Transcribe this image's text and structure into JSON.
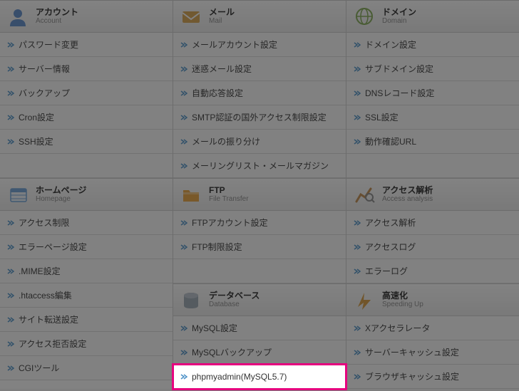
{
  "columns": [
    {
      "sections": [
        {
          "id": "account",
          "title_ja": "アカウント",
          "title_en": "Account",
          "icon": "account",
          "items": [
            {
              "label": "パスワード変更"
            },
            {
              "label": "サーバー情報"
            },
            {
              "label": "バックアップ"
            },
            {
              "label": "Cron設定"
            },
            {
              "label": "SSH設定"
            }
          ]
        },
        {
          "id": "homepage",
          "title_ja": "ホームページ",
          "title_en": "Homepage",
          "icon": "home",
          "items": [
            {
              "label": "アクセス制限"
            },
            {
              "label": "エラーページ設定"
            },
            {
              "label": ".MIME設定"
            },
            {
              "label": ".htaccess編集"
            },
            {
              "label": "サイト転送設定"
            },
            {
              "label": "アクセス拒否設定"
            },
            {
              "label": "CGIツール"
            }
          ]
        }
      ]
    },
    {
      "sections": [
        {
          "id": "mail",
          "title_ja": "メール",
          "title_en": "Mail",
          "icon": "mail",
          "items": [
            {
              "label": "メールアカウント設定"
            },
            {
              "label": "迷惑メール設定"
            },
            {
              "label": "自動応答設定"
            },
            {
              "label": "SMTP認証の国外アクセス制限設定"
            },
            {
              "label": "メールの振り分け"
            },
            {
              "label": "メーリングリスト・メールマガジン"
            }
          ]
        },
        {
          "id": "ftp",
          "title_ja": "FTP",
          "title_en": "File Transfer",
          "icon": "ftp",
          "items": [
            {
              "label": "FTPアカウント設定"
            },
            {
              "label": "FTP制限設定"
            }
          ]
        },
        {
          "id": "database",
          "title_ja": "データベース",
          "title_en": "Database",
          "icon": "db",
          "items": [
            {
              "label": "MySQL設定"
            },
            {
              "label": "MySQLバックアップ"
            },
            {
              "label": "phpmyadmin(MySQL5.7)",
              "highlight": true
            }
          ]
        }
      ]
    },
    {
      "sections": [
        {
          "id": "domain",
          "title_ja": "ドメイン",
          "title_en": "Domain",
          "icon": "domain",
          "items": [
            {
              "label": "ドメイン設定"
            },
            {
              "label": "サブドメイン設定"
            },
            {
              "label": "DNSレコード設定"
            },
            {
              "label": "SSL設定"
            },
            {
              "label": "動作確認URL"
            }
          ]
        },
        {
          "id": "access",
          "title_ja": "アクセス解析",
          "title_en": "Access analysis",
          "icon": "anal",
          "items": [
            {
              "label": "アクセス解析"
            },
            {
              "label": "アクセスログ"
            },
            {
              "label": "エラーログ"
            }
          ]
        },
        {
          "id": "speed",
          "title_ja": "高速化",
          "title_en": "Speeding Up",
          "icon": "speed",
          "items": [
            {
              "label": "Xアクセラレータ"
            },
            {
              "label": "サーバーキャッシュ設定"
            },
            {
              "label": "ブラウザキャッシュ設定"
            }
          ]
        }
      ]
    }
  ]
}
